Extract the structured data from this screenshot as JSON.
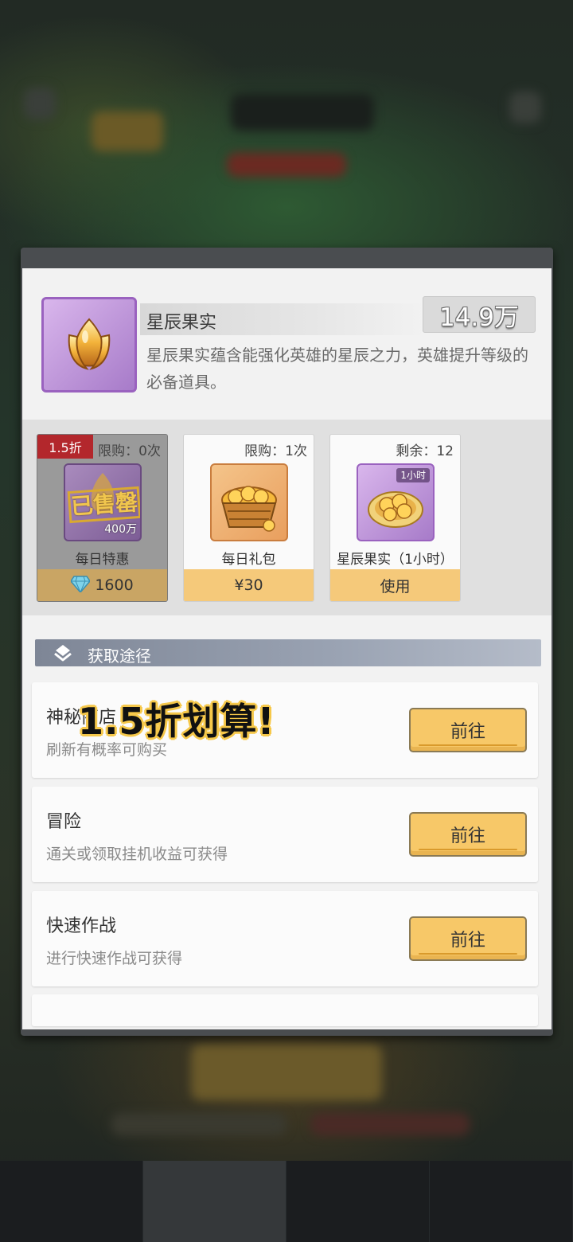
{
  "item": {
    "name": "星辰果实",
    "count": "14.9万",
    "description": "星辰果实蕴含能强化英雄的星辰之力，英雄提升等级的必备道具。",
    "icon": "tulip-fruit-icon"
  },
  "offers": [
    {
      "discount": "1.5折",
      "limit": "限购：0次",
      "label": "每日特惠",
      "price": "1600",
      "price_icon": "diamond-icon",
      "stamp": "已售罄",
      "bundle_amount": "400万",
      "sold_out": true
    },
    {
      "limit": "限购：1次",
      "label": "每日礼包",
      "price": "¥30",
      "icon": "fruit-basket-icon"
    },
    {
      "limit": "剩余：12",
      "label": "星辰果实（1小时）",
      "action": "使用",
      "time_tag": "1小时",
      "icon": "fruit-plate-icon"
    }
  ],
  "sources": {
    "title": "获取途径",
    "items": [
      {
        "title": "神秘商店",
        "desc": "刷新有概率可购买",
        "button": "前往"
      },
      {
        "title": "冒险",
        "desc": "通关或领取挂机收益可获得",
        "button": "前往"
      },
      {
        "title": "快速作战",
        "desc": "进行快速作战可获得",
        "button": "前往"
      }
    ]
  },
  "promo_overlay": "1.5折划算!",
  "colors": {
    "accent_gold": "#f5c97a",
    "discount_red": "#b3272c",
    "item_purple": "#a77bc9"
  }
}
